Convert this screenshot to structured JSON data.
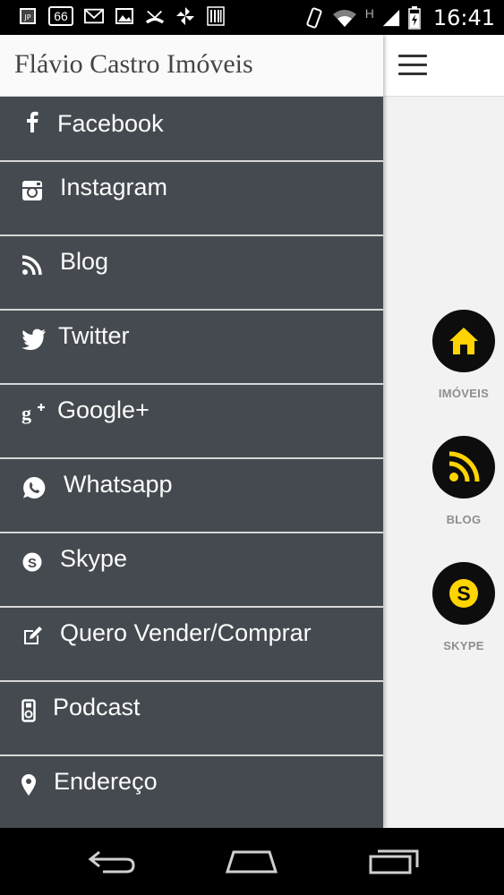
{
  "status_bar": {
    "time": "16:41",
    "notification_badge": "66",
    "network_type": "H"
  },
  "drawer": {
    "title": "Flávio Castro Imóveis",
    "items": [
      {
        "label": "Facebook",
        "icon": "facebook-icon"
      },
      {
        "label": "Instagram",
        "icon": "instagram-icon"
      },
      {
        "label": "Blog",
        "icon": "rss-icon"
      },
      {
        "label": "Twitter",
        "icon": "twitter-icon"
      },
      {
        "label": "Google+",
        "icon": "google-plus-icon"
      },
      {
        "label": "Whatsapp",
        "icon": "whatsapp-icon"
      },
      {
        "label": "Skype",
        "icon": "skype-icon"
      },
      {
        "label": "Quero Vender/Comprar",
        "icon": "edit-icon"
      },
      {
        "label": "Podcast",
        "icon": "ipod-icon"
      },
      {
        "label": "Endereço",
        "icon": "map-marker-icon"
      }
    ]
  },
  "tiles": [
    {
      "label": "IMÓVEIS",
      "icon": "home-icon"
    },
    {
      "label": "BLOG",
      "icon": "rss-icon"
    },
    {
      "label": "SKYPE",
      "icon": "skype-icon"
    }
  ],
  "colors": {
    "drawer_bg": "#454a50",
    "divider": "#d6d6d6",
    "tile_accent": "#ffd400",
    "tile_bg": "#0d0d0d"
  }
}
